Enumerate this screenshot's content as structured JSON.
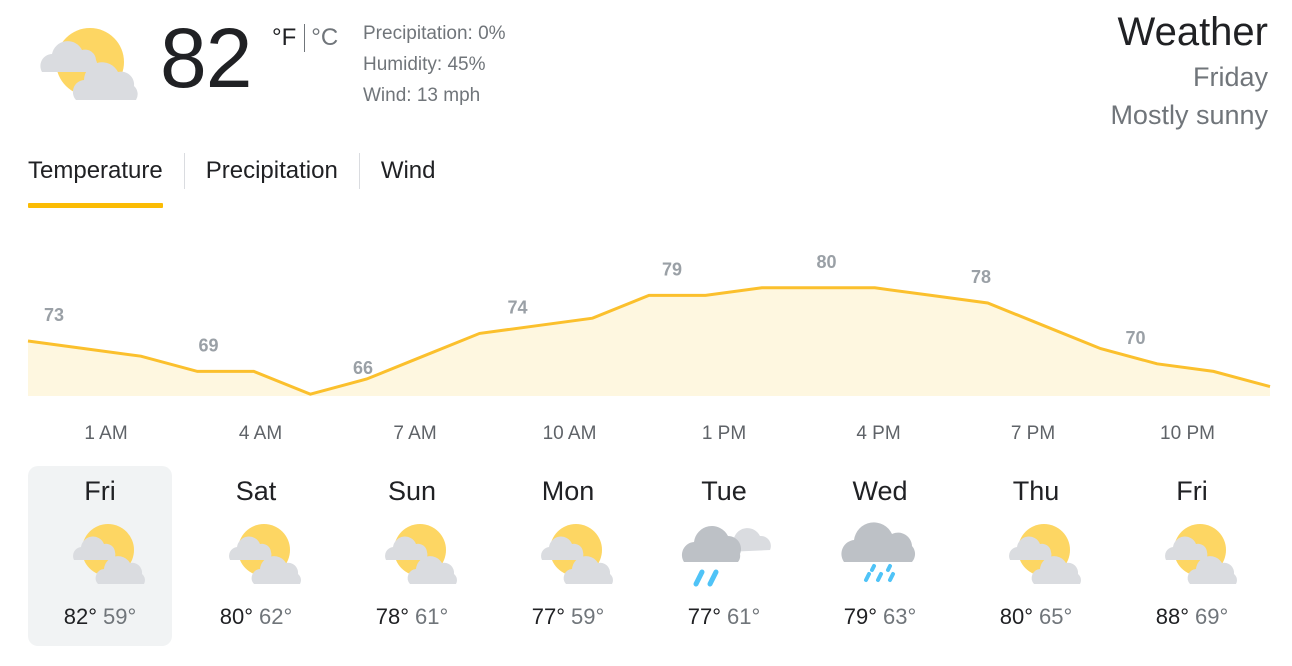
{
  "current": {
    "icon": "partly-sunny-icon",
    "temperature": "82",
    "unit_f": "°F",
    "unit_c": "°C",
    "precipitation": "Precipitation: 0%",
    "humidity": "Humidity: 45%",
    "wind": "Wind: 13 mph"
  },
  "header": {
    "title": "Weather",
    "day": "Friday",
    "condition": "Mostly sunny"
  },
  "tabs": [
    {
      "label": "Temperature",
      "active": true
    },
    {
      "label": "Precipitation",
      "active": false
    },
    {
      "label": "Wind",
      "active": false
    }
  ],
  "colors": {
    "accent": "#fbbc04",
    "area_fill": "#fef7e0",
    "line": "#fbc02d",
    "label_gray": "#9aa0a6"
  },
  "chart_data": {
    "type": "area",
    "x": [
      "1 AM",
      "4 AM",
      "7 AM",
      "10 AM",
      "1 PM",
      "4 PM",
      "7 PM",
      "10 PM"
    ],
    "values": [
      73,
      69,
      66,
      74,
      79,
      80,
      78,
      70
    ],
    "curve": [
      73,
      72,
      71,
      69,
      69,
      66,
      68,
      71,
      74,
      75,
      76,
      79,
      79,
      80,
      80,
      80,
      79,
      78,
      75,
      72,
      70,
      69,
      67
    ],
    "title": "",
    "xlabel": "",
    "ylabel": "",
    "grid": false,
    "legend": "none"
  },
  "forecast": [
    {
      "day": "Fri",
      "icon": "partly-sunny-icon",
      "high": "82°",
      "low": "59°",
      "selected": true
    },
    {
      "day": "Sat",
      "icon": "partly-sunny-icon",
      "high": "80°",
      "low": "62°",
      "selected": false
    },
    {
      "day": "Sun",
      "icon": "partly-sunny-icon",
      "high": "78°",
      "low": "61°",
      "selected": false
    },
    {
      "day": "Mon",
      "icon": "partly-sunny-icon",
      "high": "77°",
      "low": "59°",
      "selected": false
    },
    {
      "day": "Tue",
      "icon": "showers-icon",
      "high": "77°",
      "low": "61°",
      "selected": false
    },
    {
      "day": "Wed",
      "icon": "rain-icon",
      "high": "79°",
      "low": "63°",
      "selected": false
    },
    {
      "day": "Thu",
      "icon": "partly-sunny-icon",
      "high": "80°",
      "low": "65°",
      "selected": false
    },
    {
      "day": "Fri",
      "icon": "partly-sunny-icon",
      "high": "88°",
      "low": "69°",
      "selected": false
    }
  ]
}
